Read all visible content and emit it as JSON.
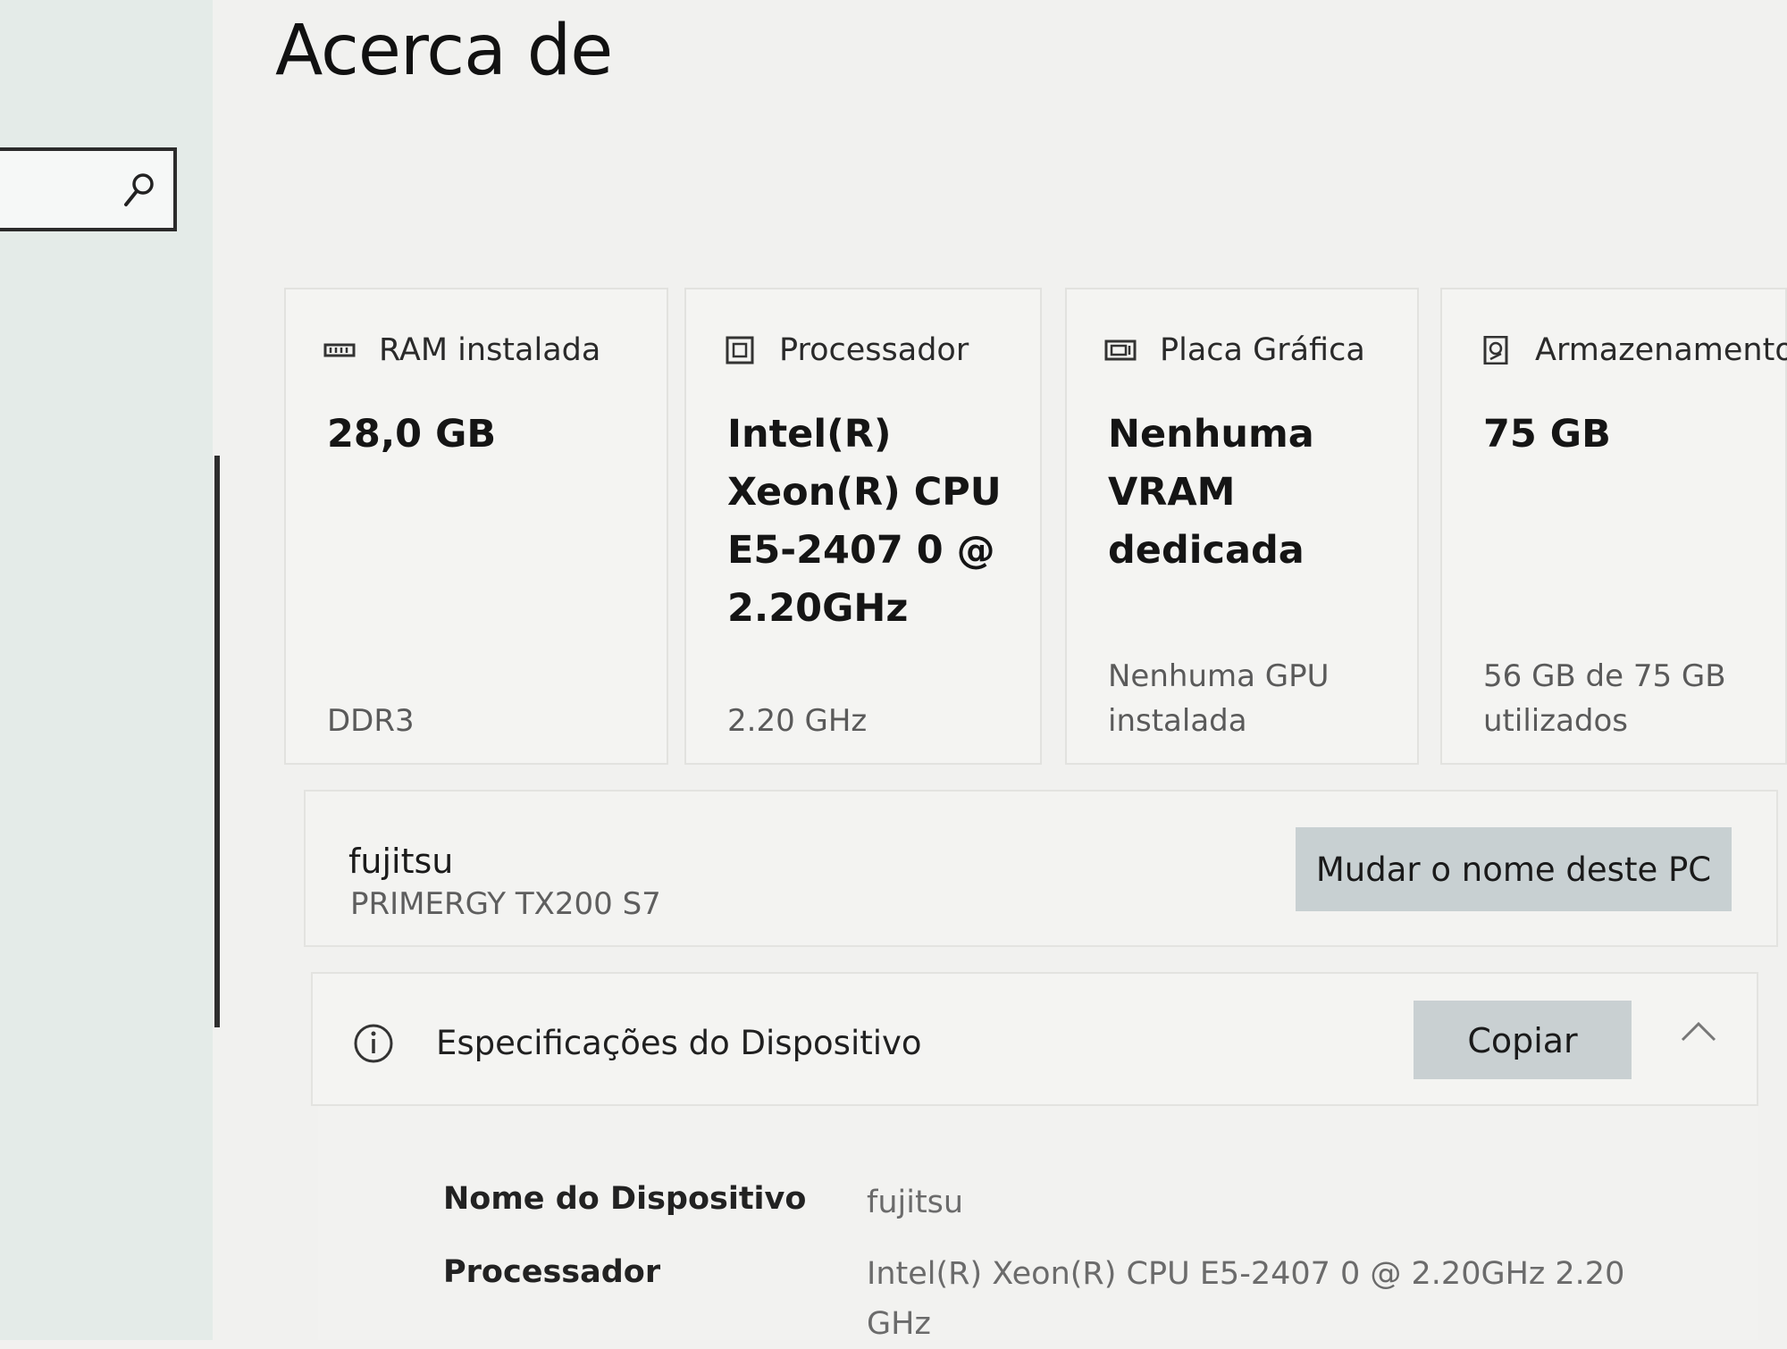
{
  "page": {
    "title": "Acerca de"
  },
  "search": {
    "placeholder": ""
  },
  "cards": {
    "ram": {
      "label": "RAM instalada",
      "value": "28,0 GB",
      "sub": "DDR3"
    },
    "cpu": {
      "label": "Processador",
      "value": "Intel(R) Xeon(R) CPU E5-2407 0 @ 2.20GHz",
      "sub": "2.20 GHz"
    },
    "gpu": {
      "label": "Placa Gráfica",
      "value": "Nenhuma VRAM dedicada",
      "sub": "Nenhuma GPU instalada"
    },
    "storage": {
      "label": "Armazenamento",
      "value": "75 GB",
      "sub": "56 GB de 75 GB utilizados"
    }
  },
  "device": {
    "name": "fujitsu",
    "model": "PRIMERGY TX200 S7",
    "rename_label": "Mudar o nome deste PC"
  },
  "specs": {
    "title": "Especificações do Dispositivo",
    "copy_label": "Copiar",
    "rows": [
      {
        "label": "Nome do Dispositivo",
        "value": "fujitsu"
      },
      {
        "label": "Processador",
        "value": "Intel(R) Xeon(R) CPU E5-2407 0 @ 2.20GHz   2.20 GHz"
      }
    ]
  },
  "icons": {
    "search": "search-icon",
    "ram": "memory-icon",
    "cpu": "processor-icon",
    "gpu": "graphics-card-icon",
    "storage": "storage-icon",
    "info": "info-icon",
    "collapse": "chevron-up-icon"
  }
}
